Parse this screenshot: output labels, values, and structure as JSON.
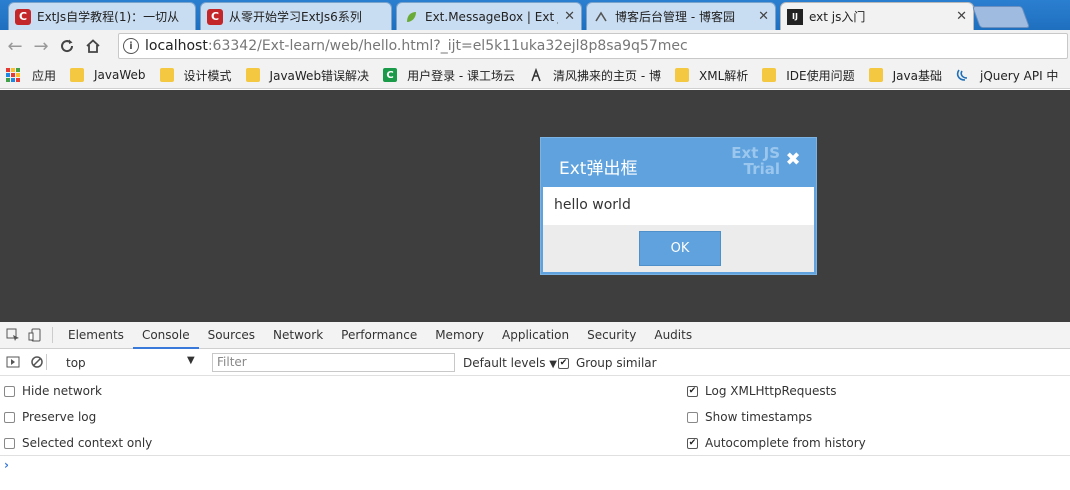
{
  "tabs": [
    {
      "title": "ExtJs自学教程(1)：一切从",
      "favicon": "C",
      "color": "#c4272a"
    },
    {
      "title": "从零开始学习ExtJs6系列",
      "favicon": "C",
      "color": "#c4272a"
    },
    {
      "title": "Ext.MessageBox | Ext JS",
      "favicon": "leaf-icon",
      "color": "#6aab37"
    },
    {
      "title": "博客后台管理 - 博客园",
      "favicon": "cnblogs-icon",
      "color": "#666666"
    },
    {
      "title": "ext js入门",
      "favicon": "intellij-icon",
      "color": "#222222"
    }
  ],
  "address": {
    "host": "localhost",
    "rest": ":63342/Ext-learn/web/hello.html?_ijt=el5k11uka32ejl8p8sa9q57mec"
  },
  "bookmarks": [
    {
      "label": "应用",
      "icon": "apps-grid-icon"
    },
    {
      "label": "JavaWeb",
      "icon": "folder-icon"
    },
    {
      "label": "设计模式",
      "icon": "folder-icon"
    },
    {
      "label": "JavaWeb错误解决",
      "icon": "folder-icon"
    },
    {
      "label": "用户登录 - 课工场云",
      "icon": "c-logo-icon"
    },
    {
      "label": "清风拂来的主页 - 博",
      "icon": "person-icon"
    },
    {
      "label": "XML解析",
      "icon": "folder-icon"
    },
    {
      "label": "IDE使用问题",
      "icon": "folder-icon"
    },
    {
      "label": "Java基础",
      "icon": "folder-icon"
    },
    {
      "label": "jQuery API 中",
      "icon": "jquery-icon"
    }
  ],
  "message_box": {
    "title": "Ext弹出框",
    "watermark_line1": "Ext JS",
    "watermark_line2": "Trial",
    "message": "hello world",
    "ok_label": "OK"
  },
  "devtools": {
    "tabs": [
      "Elements",
      "Console",
      "Sources",
      "Network",
      "Performance",
      "Memory",
      "Application",
      "Security",
      "Audits"
    ],
    "active_tab": "Console",
    "context": "top",
    "filter_placeholder": "Filter",
    "levels": "Default levels",
    "group_similar": {
      "label": "Group similar",
      "checked": true
    },
    "settings_left": [
      {
        "label": "Hide network",
        "checked": false
      },
      {
        "label": "Preserve log",
        "checked": false
      },
      {
        "label": "Selected context only",
        "checked": false
      }
    ],
    "settings_right": [
      {
        "label": "Log XMLHttpRequests",
        "checked": true
      },
      {
        "label": "Show timestamps",
        "checked": false
      },
      {
        "label": "Autocomplete from history",
        "checked": true
      }
    ]
  },
  "colors": {
    "tabstrip": "#1f6fbf",
    "page_background": "#3e3e3e",
    "extjs_blue": "#5fa2dd",
    "devtools_accent": "#3879d9"
  }
}
